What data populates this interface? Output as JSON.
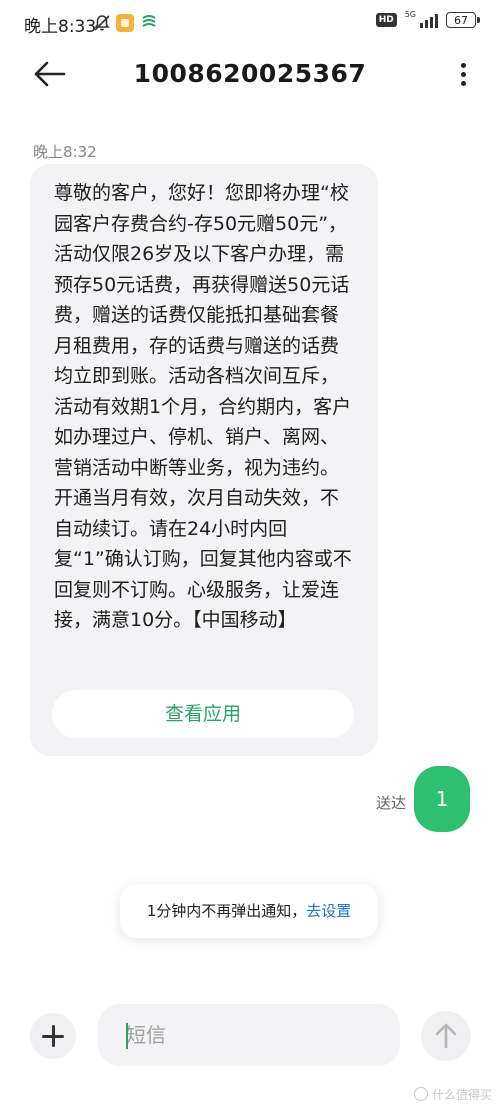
{
  "status_bar": {
    "time": "晚上8:33",
    "hd": "HD",
    "network": "5G",
    "battery": "67",
    "icons": [
      "mute-bell-icon",
      "notification-app-icon",
      "carrier-icon",
      "signal-icon",
      "battery-icon"
    ]
  },
  "header": {
    "title": "1008620025367",
    "icons": [
      "back-arrow-icon",
      "more-vertical-icon"
    ]
  },
  "conversation": {
    "incoming": {
      "time": "晚上8:32",
      "text": "尊敬的客户，您好！您即将办理“校园客户存费合约-存50元赠50元”，活动仅限26岁及以下客户办理，需预存50元话费，再获得赠送50元话费，赠送的话费仅能抵扣基础套餐月租费用，存的话费与赠送的话费均立即到账。活动各档次间互斥，活动有效期1个月，合约期内，客户如办理过户、停机、销户、离网、营销活动中断等业务，视为违约。开通当月有效，次月自动失效，不自动续订。请在24小时内回复“1”确认订购，回复其他内容或不回复则不订购。心级服务，让爱连接，满意10分。【中国移动】",
      "action_label": "查看应用"
    },
    "outgoing": {
      "status": "送达",
      "text": "1"
    }
  },
  "toast": {
    "text": "1分钟内不再弹出通知，",
    "link": "去设置"
  },
  "composer": {
    "placeholder": "短信",
    "icons": [
      "plus-icon",
      "send-arrow-up-icon"
    ]
  },
  "watermark": {
    "text": "什么值得买"
  },
  "colors": {
    "accent_green": "#2fbf71",
    "link_blue": "#1976d2",
    "bubble_gray": "#f3f3f5"
  }
}
